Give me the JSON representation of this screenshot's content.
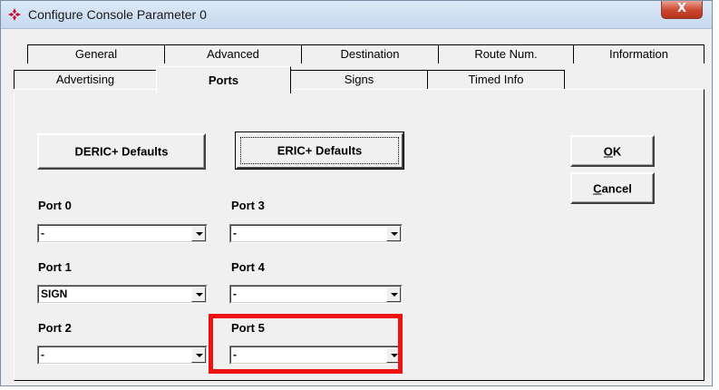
{
  "window": {
    "title": "Configure Console Parameter 0",
    "close_glyph": "X",
    "icon": "app-diamond-icon"
  },
  "tabs": {
    "row_back": [
      "General",
      "Advanced",
      "Destination",
      "Route Num.",
      "Information"
    ],
    "row_front": [
      "Advertising",
      "Ports",
      "Signs",
      "Timed Info"
    ],
    "active": "Ports"
  },
  "buttons": {
    "deric_defaults": "DERIC+ Defaults",
    "eric_defaults": "ERIC+ Defaults",
    "ok": "OK",
    "cancel": "Cancel"
  },
  "ports": [
    {
      "label": "Port 0",
      "value": "-"
    },
    {
      "label": "Port 1",
      "value": "SIGN"
    },
    {
      "label": "Port 2",
      "value": "-"
    },
    {
      "label": "Port 3",
      "value": "-"
    },
    {
      "label": "Port 4",
      "value": "-"
    },
    {
      "label": "Port 5",
      "value": "-"
    }
  ],
  "colors": {
    "highlight": "#ee1111",
    "dialog_bg": "#f0f0f0",
    "close_button": "#c9452c"
  }
}
